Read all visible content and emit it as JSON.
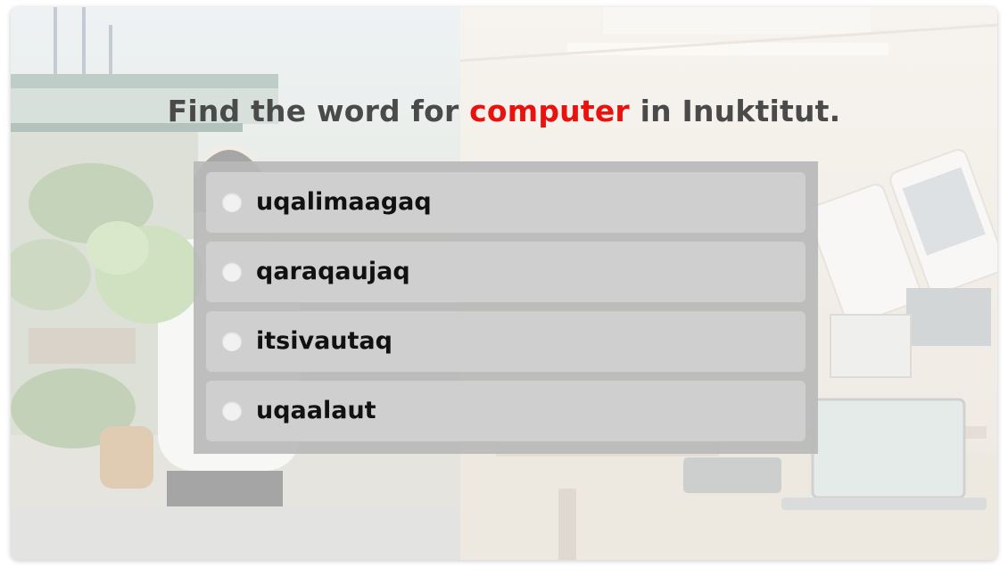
{
  "question": {
    "prefix": "Find the word for ",
    "highlight": "computer",
    "suffix": " in Inuktitut."
  },
  "options": [
    {
      "label": "uqalimaagaq",
      "selected": false
    },
    {
      "label": "qaraqaujaq",
      "selected": false
    },
    {
      "label": "itsivautaq",
      "selected": false
    },
    {
      "label": "uqaalaut",
      "selected": false
    }
  ],
  "colors": {
    "highlight": "#e8120e",
    "question_text": "#4a4a4a",
    "option_bg": "#cfcfcf",
    "panel_bg": "#b9b9b9"
  }
}
